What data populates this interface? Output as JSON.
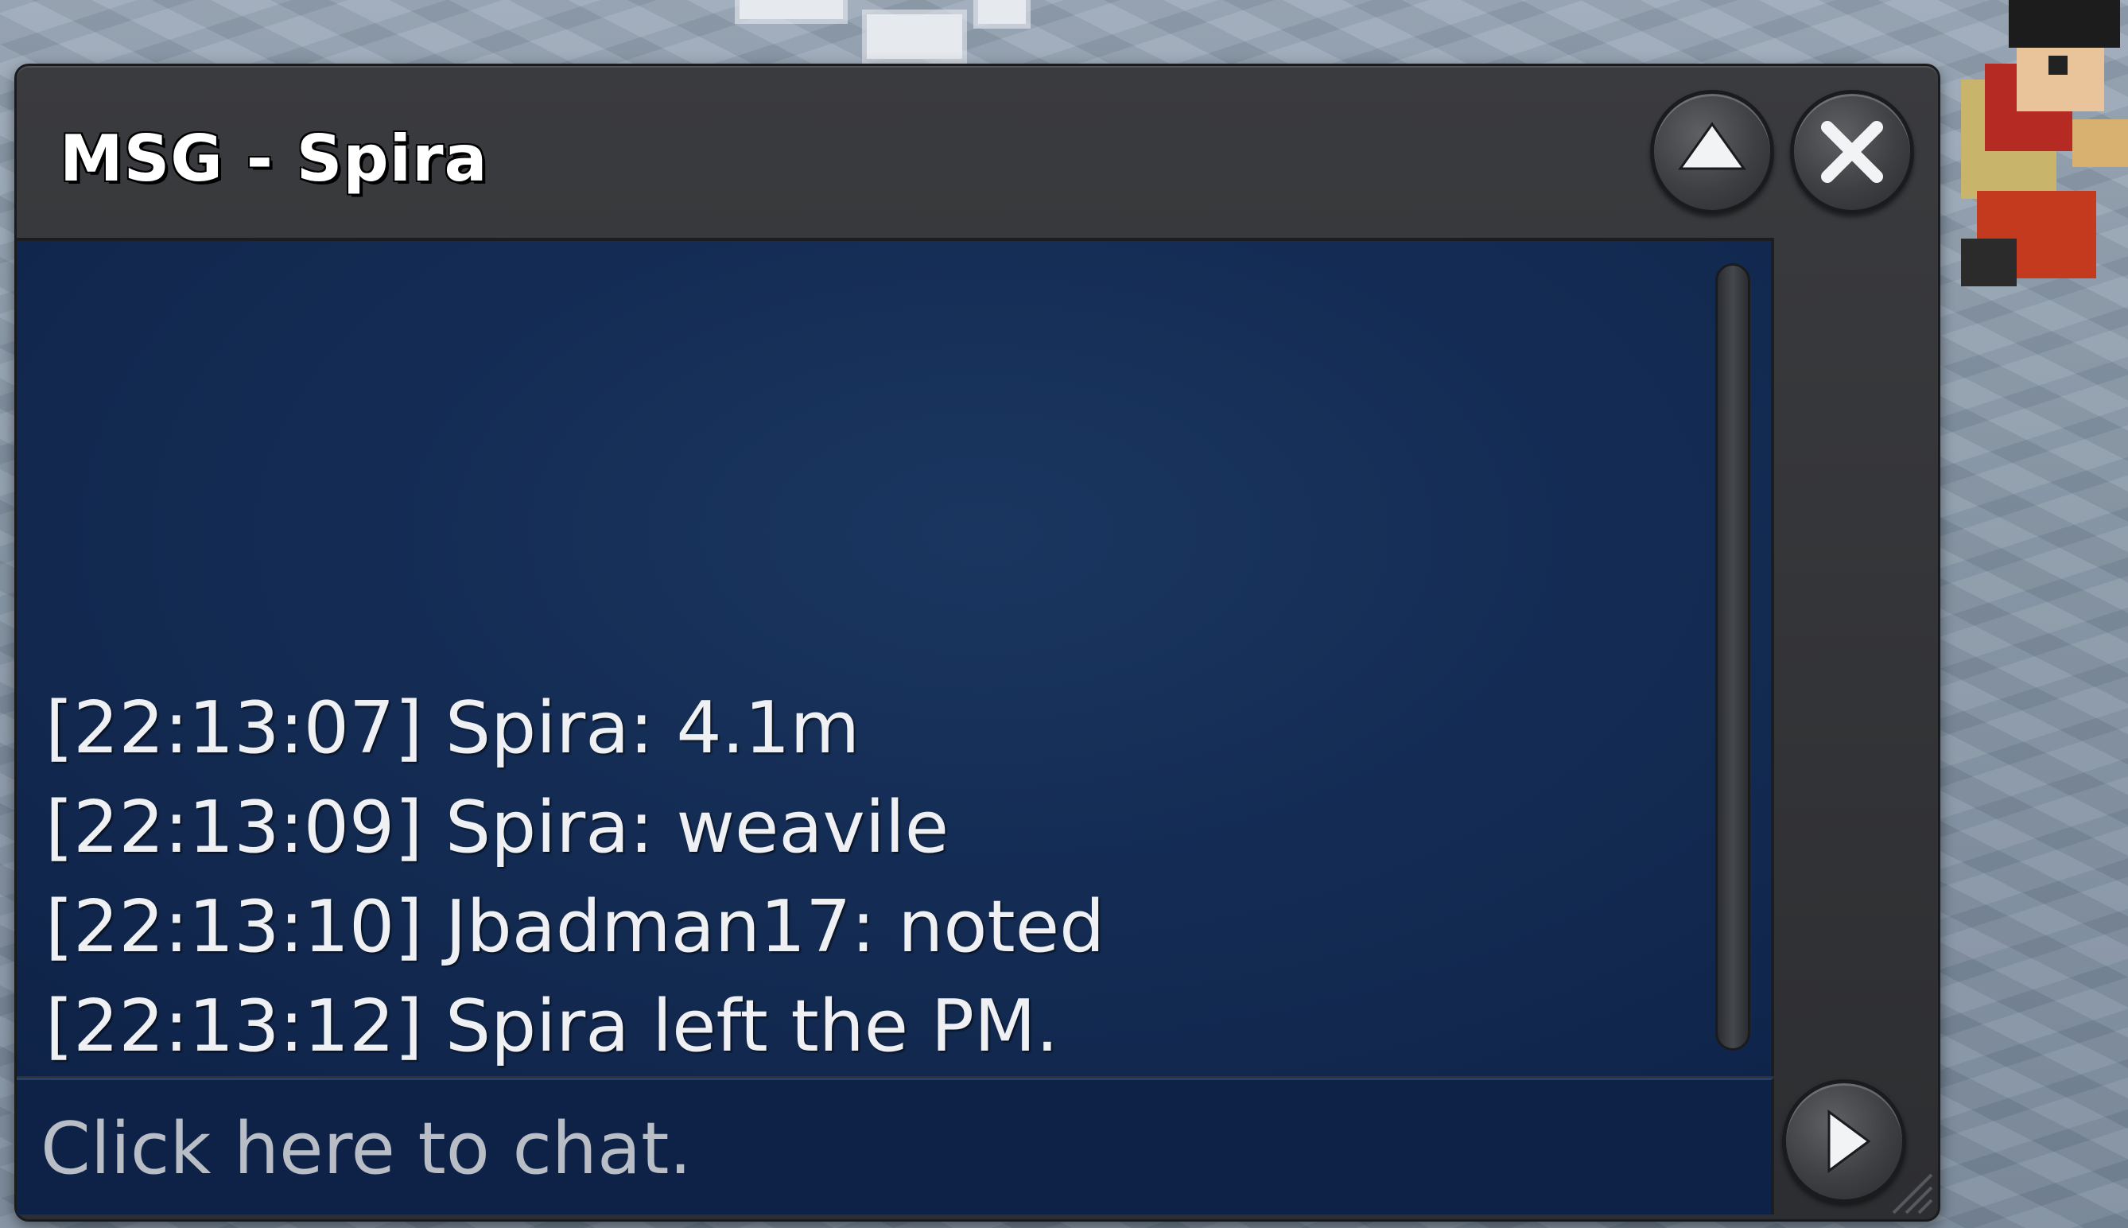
{
  "window": {
    "title": "MSG - Spira"
  },
  "messages": [
    {
      "text": "[22:13:07] Spira: 4.1m"
    },
    {
      "text": "[22:13:09] Spira: weavile"
    },
    {
      "text": "[22:13:10] Jbadman17: noted"
    },
    {
      "text": "[22:13:12] Spira left the PM."
    }
  ],
  "input": {
    "placeholder": "Click here to chat.",
    "value": ""
  },
  "icons": {
    "minimize": "chevron-up-icon",
    "close": "close-icon",
    "send": "play-arrow-icon"
  },
  "colors": {
    "window_frame": "#2d2e31",
    "message_bg": "#142c54",
    "text": "#eef0f3",
    "placeholder": "#b9bec6"
  }
}
